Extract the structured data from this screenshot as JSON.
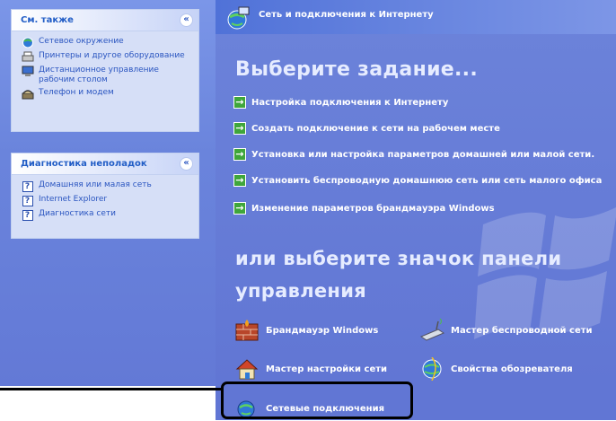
{
  "see_also": {
    "title": "См. также",
    "items": [
      {
        "label": "Сетевое окружение",
        "icon": "network-places-icon"
      },
      {
        "label": "Принтеры и другое оборудование",
        "icon": "printer-icon"
      },
      {
        "label": "Дистанционное управление рабочим столом",
        "icon": "remote-desktop-icon"
      },
      {
        "label": "Телефон и модем",
        "icon": "phone-modem-icon"
      }
    ]
  },
  "troubleshoot": {
    "title": "Диагностика неполадок",
    "items": [
      {
        "label": "Домашняя или малая сеть",
        "icon": "help-icon"
      },
      {
        "label": "Internet Explorer",
        "icon": "help-icon"
      },
      {
        "label": "Диагностика сети",
        "icon": "help-icon"
      }
    ]
  },
  "header": {
    "title": "Сеть и подключения к Интернету",
    "icon": "network-globe-icon"
  },
  "pick_task": "Выберите задание...",
  "tasks": [
    "Настройка подключения к Интернету",
    "Создать подключение к сети на рабочем месте",
    "Установка или настройка параметров домашней или малой сети.",
    "Установить беспроводную домашнюю сеть или сеть малого офиса",
    "Изменение параметров брандмауэра Windows"
  ],
  "pick_icon_line1": "или выберите значок панели",
  "pick_icon_line2": "управления",
  "control_panel_items": [
    {
      "label": "Брандмауэр Windows",
      "icon": "firewall-icon"
    },
    {
      "label": "Мастер беспроводной сети",
      "icon": "wireless-icon"
    },
    {
      "label": "Мастер настройки сети",
      "icon": "home-network-icon"
    },
    {
      "label": "Свойства обозревателя",
      "icon": "internet-options-icon"
    },
    {
      "label": "Сетевые подключения",
      "icon": "network-connections-icon"
    }
  ],
  "colors": {
    "pane_blue": "#6379d6",
    "link_blue": "#2a55c0",
    "task_green": "#3fa63b",
    "highlight": "#000000"
  }
}
